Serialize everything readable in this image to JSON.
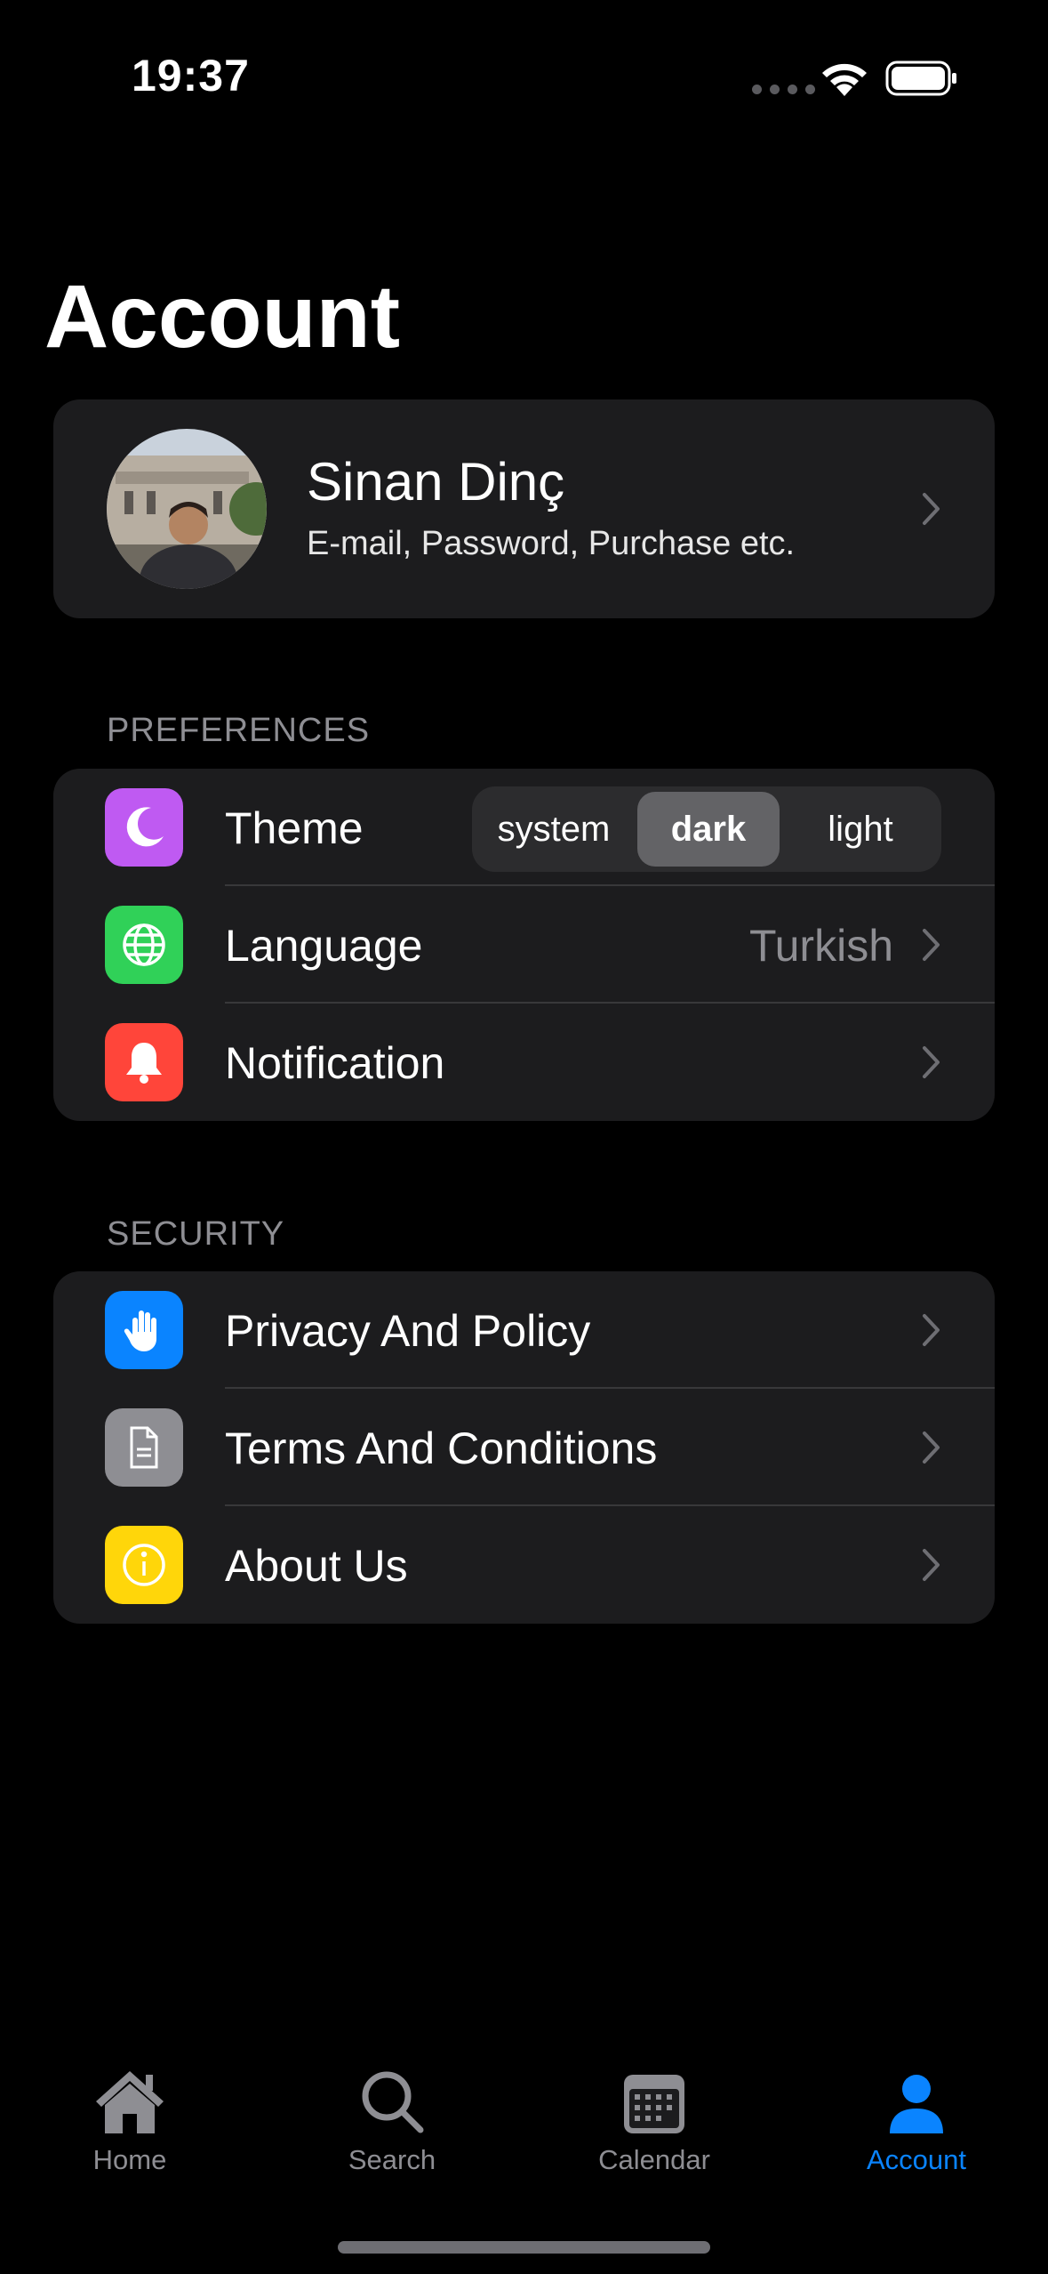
{
  "status_bar": {
    "time": "19:37"
  },
  "page": {
    "title": "Account"
  },
  "profile": {
    "name": "Sinan Dinç",
    "subtitle": "E-mail, Password, Purchase etc."
  },
  "preferences": {
    "header": "PREFERENCES",
    "theme": {
      "label": "Theme",
      "icon": "moon-icon",
      "icon_color": "#bf5af2",
      "options": [
        "system",
        "dark",
        "light"
      ],
      "selected": "dark"
    },
    "language": {
      "label": "Language",
      "value": "Turkish",
      "icon": "globe-icon",
      "icon_color": "#30d158"
    },
    "notification": {
      "label": "Notification",
      "icon": "bell-icon",
      "icon_color": "#ff453a"
    }
  },
  "security": {
    "header": "SECURITY",
    "items": [
      {
        "label": "Privacy And Policy",
        "icon": "hand-icon",
        "icon_color": "#0a84ff"
      },
      {
        "label": "Terms And Conditions",
        "icon": "document-icon",
        "icon_color": "#8e8e93"
      },
      {
        "label": "About Us",
        "icon": "info-icon",
        "icon_color": "#ffd60a"
      }
    ]
  },
  "tabbar": {
    "items": [
      {
        "label": "Home",
        "icon": "house-icon"
      },
      {
        "label": "Search",
        "icon": "magnifier-icon"
      },
      {
        "label": "Calendar",
        "icon": "calendar-icon"
      },
      {
        "label": "Account",
        "icon": "person-icon"
      }
    ],
    "active": "Account",
    "active_color": "#0a84ff",
    "inactive_color": "#8e8e93"
  }
}
